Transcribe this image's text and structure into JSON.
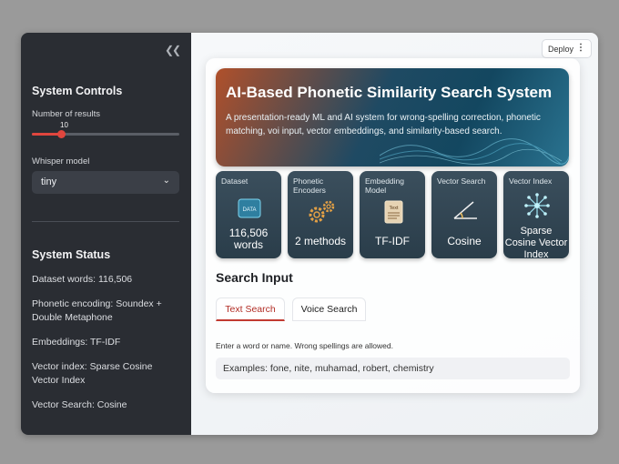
{
  "sidebar": {
    "collapse_icon": "double-chevron-left-icon",
    "controls_title": "System Controls",
    "num_results_label": "Number of results",
    "num_results_value": "10",
    "num_results_fraction": 0.2,
    "whisper_label": "Whisper model",
    "whisper_value": "tiny",
    "status_title": "System Status",
    "status_items": [
      "Dataset words: 116,506",
      "Phonetic encoding: Soundex + Double Metaphone",
      "Embeddings: TF-IDF",
      "Vector index: Sparse Cosine Vector Index",
      "Vector Search: Cosine"
    ]
  },
  "toolbar": {
    "deploy_label": "Deploy",
    "menu_icon": "vertical-dots-icon"
  },
  "hero": {
    "title": "AI-Based Phonetic Similarity Search System",
    "subtitle": "A presentation-ready ML and AI system for wrong-spelling correction, phonetic matching, voi input, vector embeddings, and similarity-based search."
  },
  "tiles": [
    {
      "label": "Dataset",
      "icon": "data-icon",
      "value": "116,506 words"
    },
    {
      "label": "Phonetic Encoders",
      "icon": "gears-icon",
      "value": "2 methods"
    },
    {
      "label": "Embedding Model",
      "icon": "text-document-icon",
      "value": "TF-IDF"
    },
    {
      "label": "Vector Search",
      "icon": "angle-icon",
      "value": "Cosine"
    },
    {
      "label": "Vector Index",
      "icon": "network-icon",
      "value": "Sparse Cosine Vector Index"
    }
  ],
  "search": {
    "title": "Search Input",
    "tabs": [
      "Text Search",
      "Voice Search"
    ],
    "active_tab": "Text Search",
    "hint": "Enter a word or name. Wrong spellings are allowed.",
    "placeholder": "Examples: fone, nite, muhamad, robert, chemistry"
  },
  "colors": {
    "accent": "#e0463e",
    "sidebar_bg": "#2a2d33",
    "tile_bg": "#33474f"
  }
}
